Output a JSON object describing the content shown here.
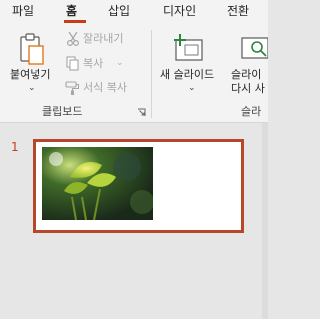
{
  "tabs": [
    {
      "label": "파일"
    },
    {
      "label": "홈"
    },
    {
      "label": "삽입"
    },
    {
      "label": "디자인"
    },
    {
      "label": "전환"
    }
  ],
  "clipboard": {
    "paste_label": "붙여넣기",
    "cut_label": "잘라내기",
    "copy_label": "복사",
    "format_painter_label": "서식 복사",
    "group_label": "클립보드"
  },
  "slides_group": {
    "new_slide_label": "새 슬라이드",
    "reuse_label_line1": "슬라이",
    "reuse_label_line2": "다시 사",
    "group_label": "슬라"
  },
  "thumbnails": [
    {
      "number": "1"
    }
  ],
  "colors": {
    "accent": "#c43e1c",
    "selection_border": "#b7472a"
  }
}
